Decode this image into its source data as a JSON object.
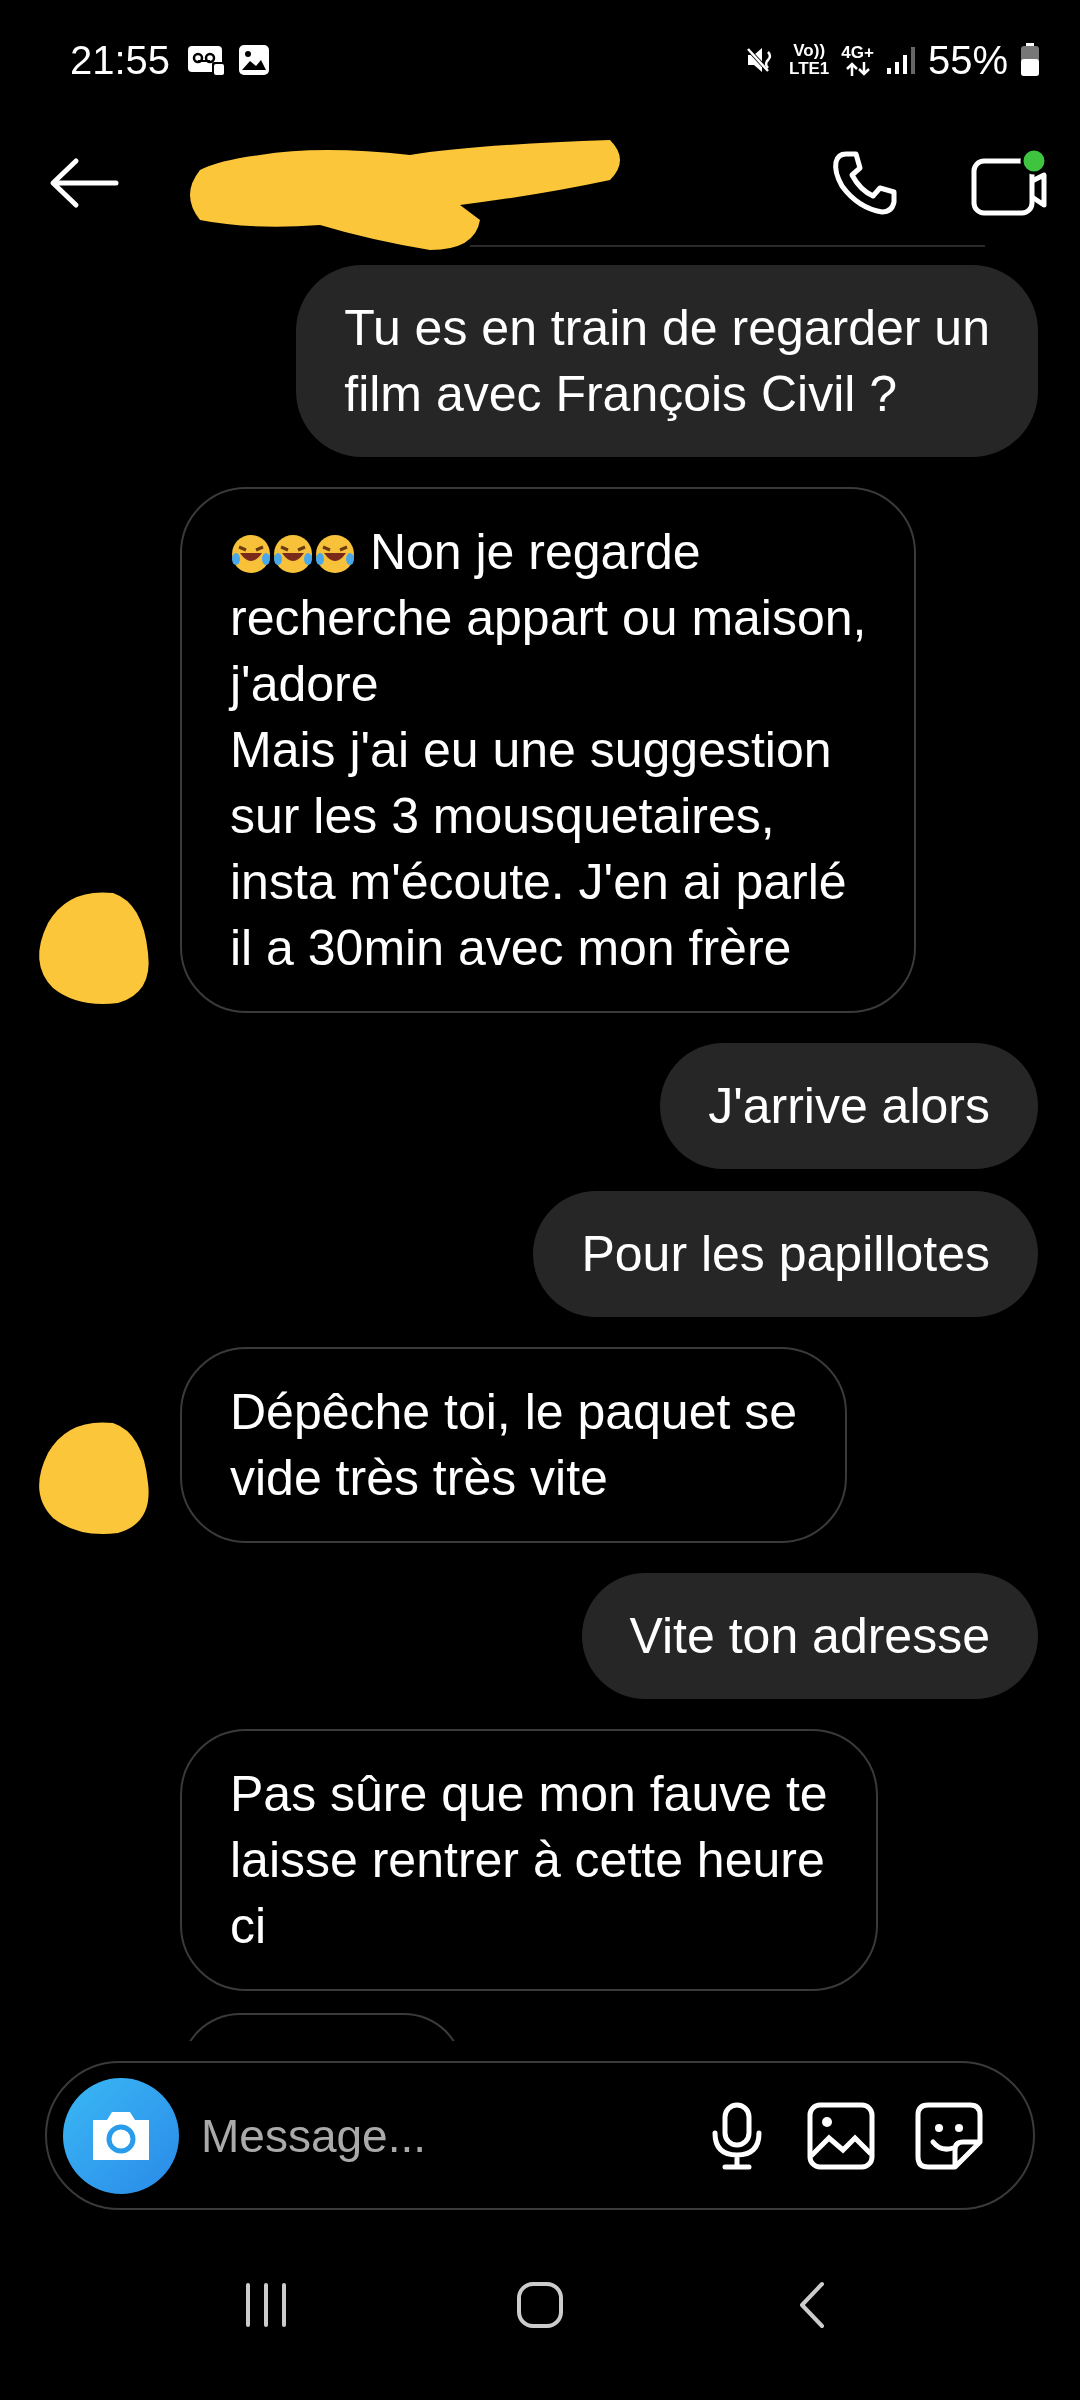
{
  "status_bar": {
    "time": "21:55",
    "network_top": "Vo))",
    "network_bottom": "LTE1",
    "data_type": "4G+",
    "battery": "55%"
  },
  "header": {
    "video_active": true
  },
  "messages": [
    {
      "kind": "sent",
      "text": "Tu es en train de regarder un\nfilm avec François Civil ?"
    },
    {
      "kind": "received",
      "avatar": true,
      "emojis": [
        {
          "kind": "rofl"
        },
        {
          "kind": "rofl"
        },
        {
          "kind": "rofl"
        }
      ],
      "text": "Non je regarde\nrecherche appart ou maison,\nj'adore\nMais j'ai eu une suggestion\nsur les 3 mousquetaires,\ninsta m'écoute. J'en ai parlé\nil a 30min avec mon frère"
    },
    {
      "kind": "sent",
      "text": "J'arrive alors"
    },
    {
      "kind": "sent",
      "text": "Pour les papillotes"
    },
    {
      "kind": "received",
      "avatar": true,
      "text": "Dépêche toi, le paquet se\nvide très très vite"
    },
    {
      "kind": "sent",
      "text": "Vite ton adresse"
    },
    {
      "kind": "received",
      "avatar": false,
      "text": "Pas sûre que mon fauve te\nlaisse rentrer à cette heure\nci"
    }
  ],
  "composer": {
    "placeholder": "Message..."
  }
}
